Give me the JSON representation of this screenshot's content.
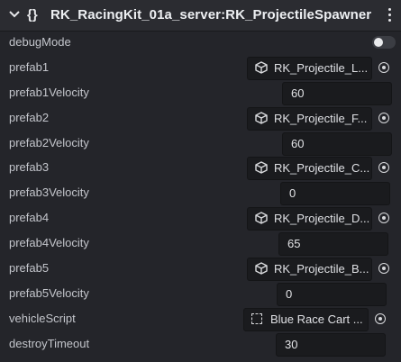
{
  "header": {
    "braces": "{}",
    "title": "RK_RacingKit_01a_server:RK_ProjectileSpawner"
  },
  "fields": {
    "debugMode": {
      "label": "debugMode",
      "value": false
    },
    "prefab1": {
      "label": "prefab1",
      "value": "RK_Projectile_L..."
    },
    "prefab1Velocity": {
      "label": "prefab1Velocity",
      "value": "60"
    },
    "prefab2": {
      "label": "prefab2",
      "value": "RK_Projectile_F..."
    },
    "prefab2Velocity": {
      "label": "prefab2Velocity",
      "value": "60"
    },
    "prefab3": {
      "label": "prefab3",
      "value": "RK_Projectile_C..."
    },
    "prefab3Velocity": {
      "label": "prefab3Velocity",
      "value": "0"
    },
    "prefab4": {
      "label": "prefab4",
      "value": "RK_Projectile_D..."
    },
    "prefab4Velocity": {
      "label": "prefab4Velocity",
      "value": "65"
    },
    "prefab5": {
      "label": "prefab5",
      "value": "RK_Projectile_B..."
    },
    "prefab5Velocity": {
      "label": "prefab5Velocity",
      "value": "0"
    },
    "vehicleScript": {
      "label": "vehicleScript",
      "value": "Blue Race Cart ..."
    },
    "destroyTimeout": {
      "label": "destroyTimeout",
      "value": "30"
    }
  },
  "icons": {
    "collapse": "chevron-down-icon",
    "menu": "kebab-menu-icon",
    "prefab": "cube-icon",
    "script": "dashed-square-icon",
    "picker": "target-picker-icon"
  }
}
